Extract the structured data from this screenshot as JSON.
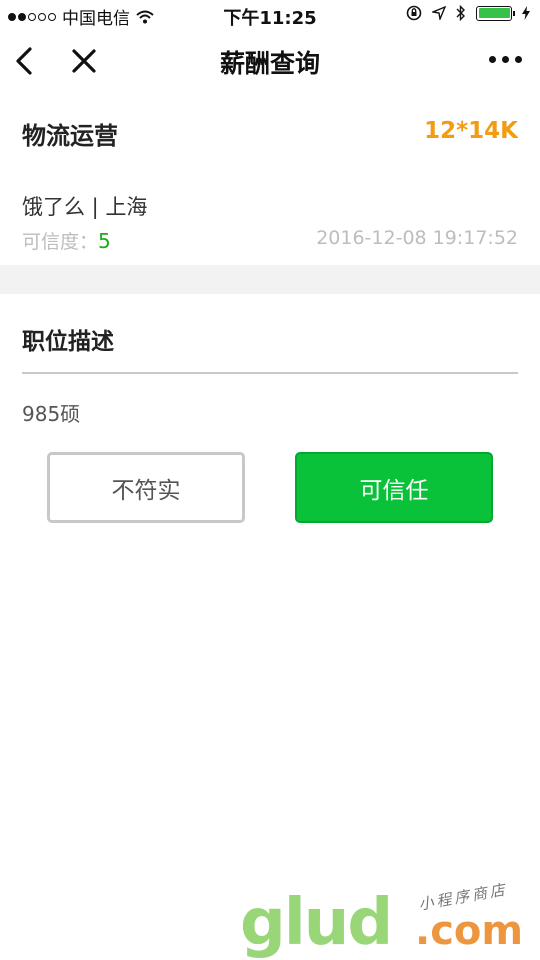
{
  "status_bar": {
    "carrier": "中国电信",
    "time": "下午11:25"
  },
  "nav": {
    "title": "薪酬查询"
  },
  "job": {
    "title": "物流运营",
    "salary": "12*14K",
    "company": "饿了么 | 上海",
    "credibility_label": "可信度：",
    "credibility_value": "5",
    "timestamp": "2016-12-08 19:17:52"
  },
  "description": {
    "heading": "职位描述",
    "text": "985硕"
  },
  "actions": {
    "untrue_label": "不符实",
    "trust_label": "可信任"
  },
  "watermark": {
    "brand": "glud",
    "domain": ".com",
    "tagline": "小程序商店"
  },
  "colors": {
    "accent_orange": "#f39c12",
    "accent_green": "#09c23a",
    "battery_green": "#36c24a"
  }
}
